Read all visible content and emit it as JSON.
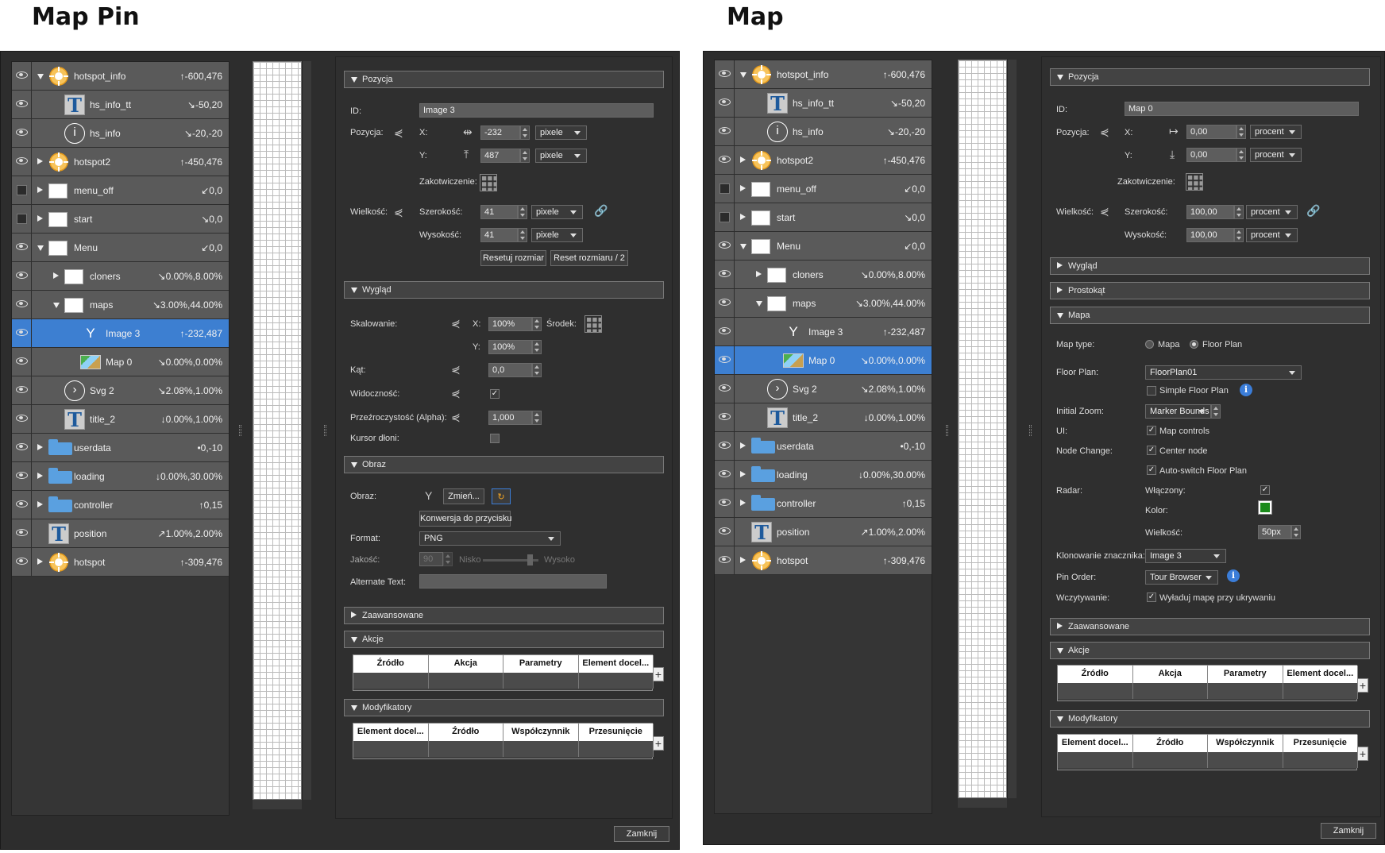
{
  "headings": {
    "left": "Map Pin",
    "right": "Map"
  },
  "close_label": "Zamknij",
  "left_tree": [
    {
      "eye": "eye",
      "arrow": "d",
      "indent": 0,
      "icon": "hotspot",
      "label": "hotspot_info",
      "value": "↑-600,476"
    },
    {
      "eye": "eye",
      "arrow": "",
      "indent": 1,
      "icon": "T",
      "label": "hs_info_tt",
      "value": "↘-50,20"
    },
    {
      "eye": "eye",
      "arrow": "",
      "indent": 1,
      "icon": "i",
      "label": "hs_info",
      "value": "↘-20,-20"
    },
    {
      "eye": "eye",
      "arrow": "r",
      "indent": 0,
      "icon": "hotspot",
      "label": "hotspot2",
      "value": "↑-450,476"
    },
    {
      "eye": "box",
      "arrow": "r",
      "indent": 0,
      "icon": "white",
      "label": "menu_off",
      "value": "↙0,0"
    },
    {
      "eye": "box",
      "arrow": "r",
      "indent": 0,
      "icon": "white",
      "label": "start",
      "value": "↘0,0"
    },
    {
      "eye": "eye",
      "arrow": "d",
      "indent": 0,
      "icon": "white",
      "label": "Menu",
      "value": "↙0,0"
    },
    {
      "eye": "eye",
      "arrow": "r",
      "indent": 1,
      "icon": "white",
      "label": "cloners",
      "value": "↘0.00%,8.00%"
    },
    {
      "eye": "eye",
      "arrow": "d",
      "indent": 1,
      "icon": "white",
      "label": "maps",
      "value": "↘3.00%,44.00%"
    },
    {
      "eye": "eye",
      "arrow": "",
      "indent": 2,
      "icon": "Y",
      "label": "Image 3",
      "value": "↑-232,487",
      "selected": true
    },
    {
      "eye": "eye",
      "arrow": "",
      "indent": 2,
      "icon": "map",
      "label": "Map 0",
      "value": "↘0.00%,0.00%"
    },
    {
      "eye": "eye",
      "arrow": "",
      "indent": 1,
      "icon": ">",
      "label": "Svg 2",
      "value": "↘2.08%,1.00%"
    },
    {
      "eye": "eye",
      "arrow": "",
      "indent": 1,
      "icon": "T",
      "label": "title_2",
      "value": "↓0.00%,1.00%"
    },
    {
      "eye": "eye",
      "arrow": "r",
      "indent": 0,
      "icon": "folder",
      "label": "userdata",
      "value": "•0,-10"
    },
    {
      "eye": "eye",
      "arrow": "r",
      "indent": 0,
      "icon": "folder",
      "label": "loading",
      "value": "↓0.00%,30.00%"
    },
    {
      "eye": "eye",
      "arrow": "r",
      "indent": 0,
      "icon": "folder",
      "label": "controller",
      "value": "↑0,15"
    },
    {
      "eye": "eye",
      "arrow": "",
      "indent": 0,
      "icon": "T",
      "label": "position",
      "value": "↗1.00%,2.00%"
    },
    {
      "eye": "eye",
      "arrow": "r",
      "indent": 0,
      "icon": "hotspot",
      "label": "hotspot",
      "value": "↑-309,476"
    }
  ],
  "right_tree": [
    {
      "eye": "eye",
      "arrow": "d",
      "indent": 0,
      "icon": "hotspot",
      "label": "hotspot_info",
      "value": "↑-600,476"
    },
    {
      "eye": "eye",
      "arrow": "",
      "indent": 1,
      "icon": "T",
      "label": "hs_info_tt",
      "value": "↘-50,20"
    },
    {
      "eye": "eye",
      "arrow": "",
      "indent": 1,
      "icon": "i",
      "label": "hs_info",
      "value": "↘-20,-20"
    },
    {
      "eye": "eye",
      "arrow": "r",
      "indent": 0,
      "icon": "hotspot",
      "label": "hotspot2",
      "value": "↑-450,476"
    },
    {
      "eye": "box",
      "arrow": "r",
      "indent": 0,
      "icon": "white",
      "label": "menu_off",
      "value": "↙0,0"
    },
    {
      "eye": "box",
      "arrow": "r",
      "indent": 0,
      "icon": "white",
      "label": "start",
      "value": "↘0,0"
    },
    {
      "eye": "eye",
      "arrow": "d",
      "indent": 0,
      "icon": "white",
      "label": "Menu",
      "value": "↙0,0"
    },
    {
      "eye": "eye",
      "arrow": "r",
      "indent": 1,
      "icon": "white",
      "label": "cloners",
      "value": "↘0.00%,8.00%"
    },
    {
      "eye": "eye",
      "arrow": "d",
      "indent": 1,
      "icon": "white",
      "label": "maps",
      "value": "↘3.00%,44.00%"
    },
    {
      "eye": "eye",
      "arrow": "",
      "indent": 2,
      "icon": "Y",
      "label": "Image 3",
      "value": "↑-232,487"
    },
    {
      "eye": "eye",
      "arrow": "",
      "indent": 2,
      "icon": "map",
      "label": "Map 0",
      "value": "↘0.00%,0.00%",
      "selected": true
    },
    {
      "eye": "eye",
      "arrow": "",
      "indent": 1,
      "icon": ">",
      "label": "Svg 2",
      "value": "↘2.08%,1.00%"
    },
    {
      "eye": "eye",
      "arrow": "",
      "indent": 1,
      "icon": "T",
      "label": "title_2",
      "value": "↓0.00%,1.00%"
    },
    {
      "eye": "eye",
      "arrow": "r",
      "indent": 0,
      "icon": "folder",
      "label": "userdata",
      "value": "•0,-10"
    },
    {
      "eye": "eye",
      "arrow": "r",
      "indent": 0,
      "icon": "folder",
      "label": "loading",
      "value": "↓0.00%,30.00%"
    },
    {
      "eye": "eye",
      "arrow": "r",
      "indent": 0,
      "icon": "folder",
      "label": "controller",
      "value": "↑0,15"
    },
    {
      "eye": "eye",
      "arrow": "",
      "indent": 0,
      "icon": "T",
      "label": "position",
      "value": "↗1.00%,2.00%"
    },
    {
      "eye": "eye",
      "arrow": "r",
      "indent": 0,
      "icon": "hotspot",
      "label": "hotspot",
      "value": "↑-309,476"
    }
  ],
  "left_props": {
    "sec_pozycja": "Pozycja",
    "id_label": "ID:",
    "id_value": "Image 3",
    "pos_label": "Pozycja:",
    "x_label": "X:",
    "x_value": "-232",
    "x_unit": "pixele",
    "y_label": "Y:",
    "y_value": "487",
    "y_unit": "pixele",
    "anchor_label": "Zakotwiczenie:",
    "size_label": "Wielkość:",
    "width_label": "Szerokość:",
    "width_value": "41",
    "width_unit": "pixele",
    "height_label": "Wysokość:",
    "height_value": "41",
    "height_unit": "pixele",
    "reset_btn": "Resetuj rozmiar",
    "reset_half_btn": "Reset rozmiaru / 2",
    "sec_wyglad": "Wygląd",
    "scale_label": "Skalowanie:",
    "sx_label": "X:",
    "sx_value": "100%",
    "center_label": "Środek:",
    "sy_label": "Y:",
    "sy_value": "100%",
    "angle_label": "Kąt:",
    "angle_value": "0,0",
    "visibility_label": "Widoczność:",
    "alpha_label": "Przeźroczystość (Alpha):",
    "alpha_value": "1,000",
    "cursor_label": "Kursor dłoni:",
    "sec_obraz": "Obraz",
    "image_label": "Obraz:",
    "change_btn": "Zmień...",
    "convert_btn": "Konwersja do przycisku",
    "format_label": "Format:",
    "format_value": "PNG",
    "quality_label": "Jakość:",
    "quality_value": "90",
    "quality_low": "Nisko",
    "quality_high": "Wysoko",
    "alt_label": "Alternate Text:",
    "sec_zaawansowane": "Zaawansowane",
    "sec_akcje": "Akcje",
    "akcje_cols": [
      "Źródło",
      "Akcja",
      "Parametry",
      "Element docel..."
    ],
    "sec_modyfikatory": "Modyfikatory",
    "mod_cols": [
      "Element docel...",
      "Źródło",
      "Współczynnik",
      "Przesunięcie"
    ]
  },
  "right_props": {
    "sec_pozycja": "Pozycja",
    "id_label": "ID:",
    "id_value": "Map 0",
    "pos_label": "Pozycja:",
    "x_label": "X:",
    "x_value": "0,00",
    "x_unit": "procent",
    "y_label": "Y:",
    "y_value": "0,00",
    "y_unit": "procent",
    "anchor_label": "Zakotwiczenie:",
    "size_label": "Wielkość:",
    "width_label": "Szerokość:",
    "width_value": "100,00",
    "width_unit": "procent",
    "height_label": "Wysokość:",
    "height_value": "100,00",
    "height_unit": "procent",
    "sec_wyglad": "Wygląd",
    "sec_prostokat": "Prostokąt",
    "sec_mapa": "Mapa",
    "maptype_label": "Map type:",
    "maptype_opt1": "Mapa",
    "maptype_opt2": "Floor Plan",
    "floorplan_label": "Floor Plan:",
    "floorplan_value": "FloorPlan01",
    "simple_floor": "Simple Floor Plan",
    "zoom_label": "Initial Zoom:",
    "zoom_value": "Marker Bounds",
    "ui_label": "UI:",
    "ui_opt": "Map controls",
    "node_label": "Node Change:",
    "node_opt1": "Center node",
    "node_opt2": "Auto-switch Floor Plan",
    "radar_label": "Radar:",
    "radar_on": "Włączony:",
    "radar_color": "Kolor:",
    "radar_size": "Wielkość:",
    "radar_size_value": "50px",
    "radar_color_hex": "#1a8a1a",
    "clone_label": "Klonowanie znacznika:",
    "clone_value": "Image 3",
    "pin_label": "Pin Order:",
    "pin_value": "Tour Browser",
    "load_label": "Wczytywanie:",
    "load_opt": "Wyładuj mapę przy ukrywaniu",
    "sec_zaawansowane": "Zaawansowane",
    "sec_akcje": "Akcje",
    "akcje_cols": [
      "Źródło",
      "Akcja",
      "Parametry",
      "Element docel..."
    ],
    "sec_modyfikatory": "Modyfikatory",
    "mod_cols": [
      "Element docel...",
      "Źródło",
      "Współczynnik",
      "Przesunięcie"
    ]
  }
}
